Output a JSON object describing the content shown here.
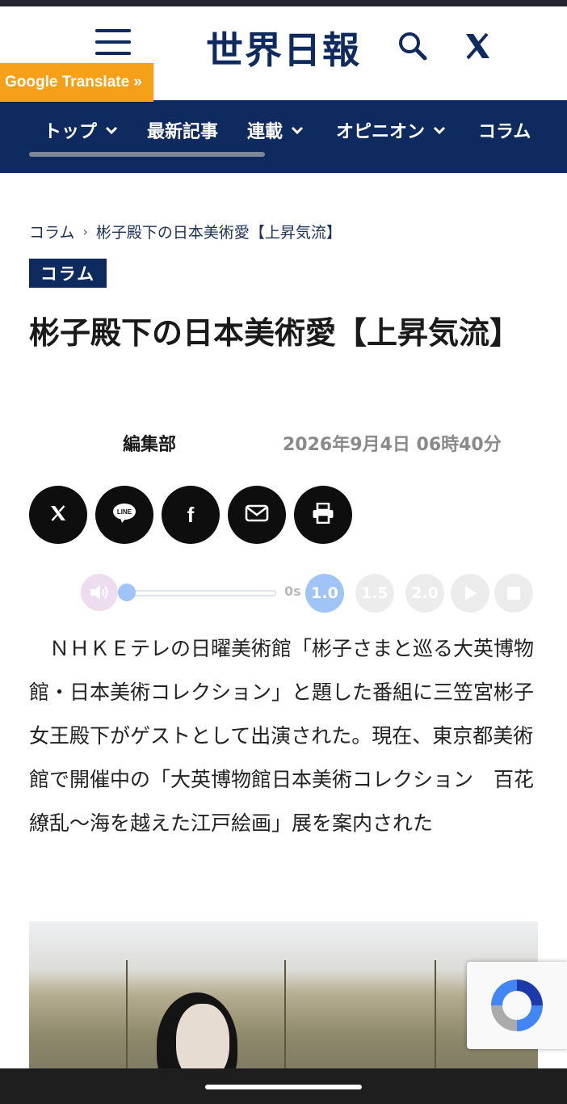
{
  "header": {
    "logo_text": "世界日報",
    "google_translate_label": "Google Translate »",
    "brand_color": "#0f2a5e",
    "icons": [
      "menu-icon",
      "search-icon",
      "x-logo-icon"
    ]
  },
  "nav": {
    "items": [
      {
        "label": "トップ",
        "has_dropdown": true
      },
      {
        "label": "最新記事",
        "has_dropdown": false
      },
      {
        "label": "連載",
        "has_dropdown": true
      },
      {
        "label": "オピニオン",
        "has_dropdown": true
      },
      {
        "label": "コラム",
        "has_dropdown": false
      }
    ]
  },
  "breadcrumb": {
    "items": [
      "コラム",
      "彬子殿下の日本美術愛【上昇気流】"
    ],
    "separator": "›"
  },
  "article": {
    "category": "コラム",
    "title": "彬子殿下の日本美術愛【上昇気流】",
    "author": "編集部",
    "date": "2026年9月4日 06時40分",
    "body": "　ＮＨＫＥテレの日曜美術館「彬子さまと巡る大英博物館・日本美術コレクション」と題した番組に三笠宮彬子女王殿下がゲストとして出演された。現在、東京都美術館で開催中の「大英博物館日本美術コレクション　百花繚乱〜海を越えた江戸絵画」展を案内された"
  },
  "share": {
    "buttons": [
      {
        "name": "x",
        "glyph": "𝕏"
      },
      {
        "name": "line",
        "glyph": "LINE"
      },
      {
        "name": "facebook",
        "glyph": "f"
      },
      {
        "name": "email",
        "glyph": "envelope"
      },
      {
        "name": "print",
        "glyph": "printer"
      }
    ]
  },
  "audio_player": {
    "time": "0s",
    "speeds": [
      "1.0",
      "1.5",
      "2.0"
    ],
    "active_speed": "1.0",
    "progress": 0,
    "accent_color": "#2f7ef0"
  }
}
